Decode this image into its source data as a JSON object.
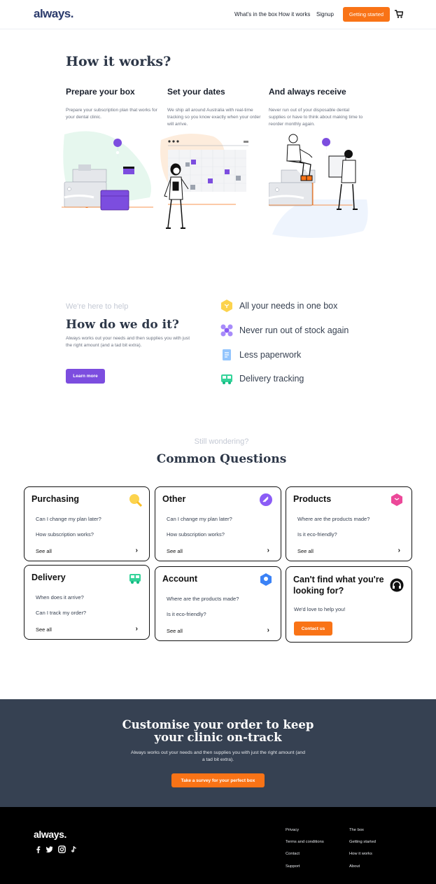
{
  "nav": {
    "logo": "always.",
    "links": [
      "What's in the box",
      "How it works",
      "Signup"
    ],
    "cta": "Getting started"
  },
  "how_it_works": {
    "title": "How it works?",
    "steps": [
      {
        "title": "Prepare your box",
        "desc": "Prepare your subscription plan that works for your dental clinic."
      },
      {
        "title": "Set your dates",
        "desc": "We ship all around Australia with real-time tracking so you know exactly when your order will arrive."
      },
      {
        "title": "And always receive",
        "desc": "Never run out of your disposable dental supplies or have to think about making time to reorder monthly again."
      }
    ]
  },
  "how_we_do": {
    "eyebrow": "We're here to help",
    "title": "How do we do it?",
    "desc": "Always works out your needs and then supplies you with just the right amount (and a tad bit extra).",
    "button": "Learn more",
    "features": [
      {
        "label": "All your needs in one box",
        "icon": "box-icon",
        "color": "#fbbf24"
      },
      {
        "label": "Never run out of stock again",
        "icon": "stock-icon",
        "color": "#a78bfa"
      },
      {
        "label": "Less paperwork",
        "icon": "paperwork-icon",
        "color": "#60a5fa"
      },
      {
        "label": "Delivery tracking",
        "icon": "truck-icon",
        "color": "#34d399"
      }
    ]
  },
  "faq": {
    "eyebrow": "Still wondering?",
    "title": "Common Questions",
    "see_all": "See all",
    "cards": [
      {
        "title": "Purchasing",
        "questions": [
          "Can I change my plan later?",
          "How subscription works?"
        ],
        "icon": "search-icon",
        "color": "#fbbf24"
      },
      {
        "title": "Other",
        "questions": [
          "Can I change my plan later?",
          "How subscription works?"
        ],
        "icon": "tag-icon",
        "color": "#8b5cf6"
      },
      {
        "title": "Products",
        "questions": [
          "Where are the products made?",
          "Is it eco-friendly?"
        ],
        "icon": "product-icon",
        "color": "#ec4899"
      },
      {
        "title": "Delivery",
        "questions": [
          "When does it arrive?",
          "Can I track my order?"
        ],
        "icon": "truck-icon",
        "color": "#34d399"
      },
      {
        "title": "Account",
        "questions": [
          "Where are the products made?",
          "Is it eco-friendly?"
        ],
        "icon": "account-icon",
        "color": "#3b82f6"
      }
    ],
    "help": {
      "title": "Can't find what you're looking for?",
      "desc": "We'd love to help you!",
      "button": "Contact us",
      "icon": "headset-icon"
    }
  },
  "banner": {
    "title_line1": "Customise your order to keep",
    "title_line2": "your clinic on-track",
    "desc": "Always works out your needs and then supplies you with just the right amount (and a tad bit extra).",
    "button": "Take a survey for your perfect box"
  },
  "footer": {
    "logo": "always.",
    "social": [
      "facebook-icon",
      "twitter-icon",
      "instagram-icon",
      "tiktok-icon"
    ],
    "col1": [
      "Privacy",
      "Terms and conditions",
      "Contact",
      "Support"
    ],
    "col2": [
      "The box",
      "Getting started",
      "How it works",
      "About"
    ]
  },
  "colors": {
    "accent": "#f97316",
    "purple": "#7c4ddf",
    "navy": "#364152"
  }
}
